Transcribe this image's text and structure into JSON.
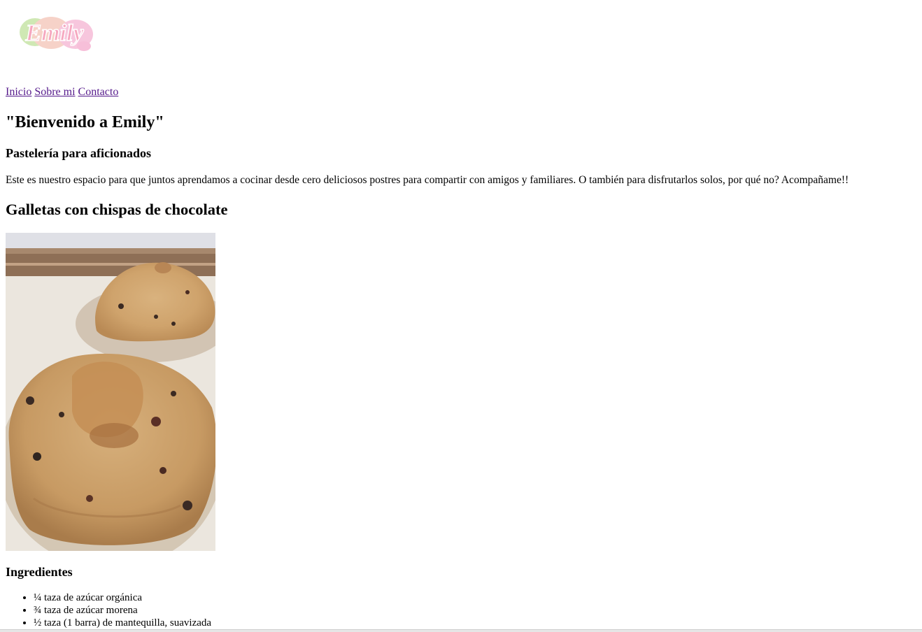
{
  "logo": {
    "text": "Emily",
    "colors": {
      "green": "#cfe8b4",
      "peach": "#f6d2c8",
      "pink": "#f7bfd9",
      "text": "#f08fb0"
    }
  },
  "nav": {
    "items": [
      {
        "label": "Inicio"
      },
      {
        "label": "Sobre mi"
      },
      {
        "label": "Contacto"
      }
    ],
    "link_color": "#551a8b"
  },
  "header": {
    "title": "\"Bienvenido a Emily\"",
    "subtitle": "Pastelería para aficionados"
  },
  "intro": "Este es nuestro espacio para que juntos aprendamos a cocinar desde cero deliciosos postres para compartir con amigos y familiares. O también para disfrutarlos solos, por qué no? Acompañame!!",
  "recipe": {
    "title": "Galletas con chispas de chocolate",
    "ingredients_title": "Ingredientes",
    "ingredients": [
      "¼ taza de azúcar orgánica",
      "¾ taza de azúcar morena",
      "½ taza (1 barra) de mantequilla, suavizada"
    ]
  }
}
